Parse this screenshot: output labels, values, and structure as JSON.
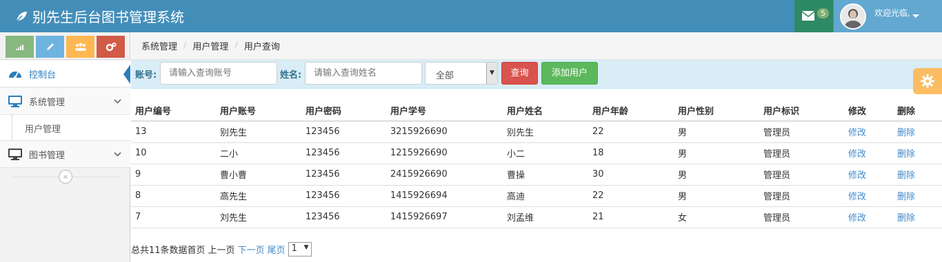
{
  "app": {
    "title": "别先生后台图书管理系统"
  },
  "header": {
    "message_count": "5",
    "welcome": "欢迎光临,"
  },
  "sidebar": {
    "items": [
      {
        "label": "控制台"
      },
      {
        "label": "系统管理"
      },
      {
        "label": "用户管理"
      },
      {
        "label": "图书管理"
      }
    ],
    "collapse_label": "«"
  },
  "breadcrumb": [
    "系统管理",
    "用户管理",
    "用户查询"
  ],
  "search": {
    "account_label": "账号:",
    "account_placeholder": "请输入查询账号",
    "name_label": "姓名:",
    "name_placeholder": "请输入查询姓名",
    "filter_value": "全部",
    "query_button": "查询",
    "add_button": "添加用户"
  },
  "table": {
    "headers": [
      "用户编号",
      "用户账号",
      "用户密码",
      "用户学号",
      "用户姓名",
      "用户年龄",
      "用户性别",
      "用户标识",
      "修改",
      "删除"
    ],
    "rows": [
      [
        "13",
        "别先生",
        "123456",
        "3215926690",
        "别先生",
        "22",
        "男",
        "管理员",
        "修改",
        "删除"
      ],
      [
        "10",
        "二小",
        "123456",
        "1215926690",
        "小二",
        "18",
        "男",
        "管理员",
        "修改",
        "删除"
      ],
      [
        "9",
        "曹小曹",
        "123456",
        "2415926690",
        "曹操",
        "30",
        "男",
        "管理员",
        "修改",
        "删除"
      ],
      [
        "8",
        "高先生",
        "123456",
        "1415926694",
        "高迪",
        "22",
        "男",
        "管理员",
        "修改",
        "删除"
      ],
      [
        "7",
        "刘先生",
        "123456",
        "1415926697",
        "刘孟维",
        "21",
        "女",
        "管理员",
        "修改",
        "删除"
      ]
    ]
  },
  "pagination": {
    "summary": "总共11条数据首页",
    "prev": "上一页",
    "next": "下一页",
    "last": "尾页",
    "page_value": "1"
  },
  "colors": {
    "header_bg": "#438eb9",
    "accent": "#2b7dbc",
    "danger": "#d9534f",
    "success": "#5cb85c"
  }
}
